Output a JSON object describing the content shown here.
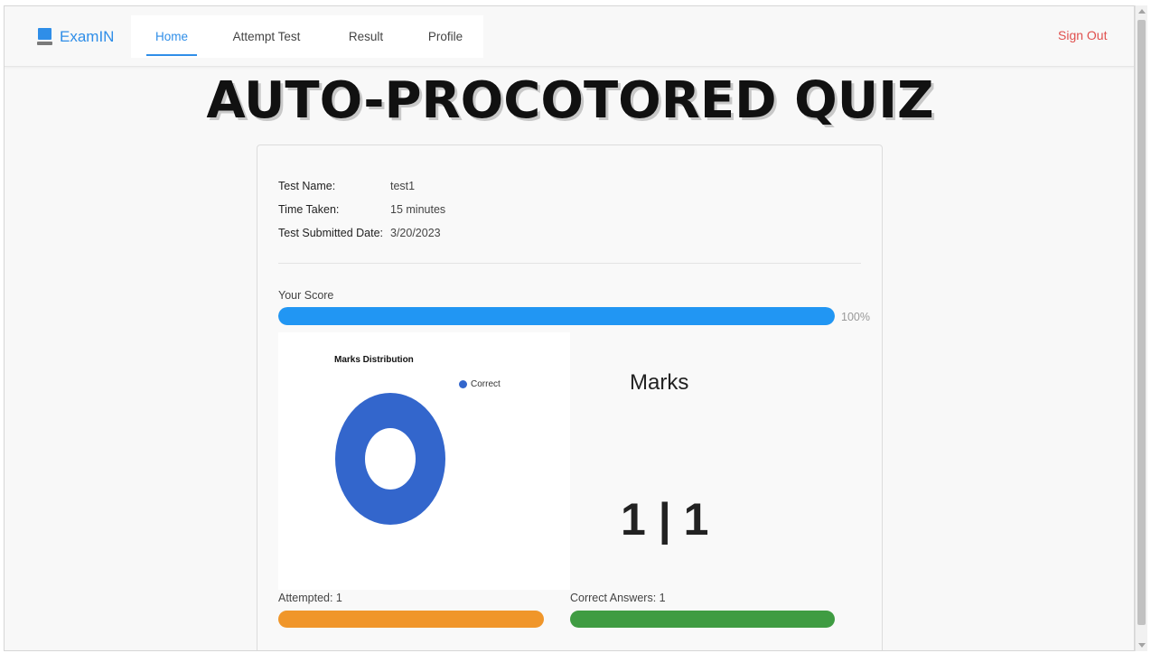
{
  "brand": {
    "name": "ExamIN",
    "icon": "laptop-icon",
    "color": "#2f8ee8"
  },
  "nav": {
    "tabs": [
      {
        "label": "Home",
        "active": true
      },
      {
        "label": "Attempt Test",
        "active": false
      },
      {
        "label": "Result",
        "active": false
      },
      {
        "label": "Profile",
        "active": false
      }
    ],
    "signout_label": "Sign Out"
  },
  "headline": "AUTO-PROCOTORED QUIZ",
  "result": {
    "test_name_label": "Test Name:",
    "test_name": "test1",
    "time_taken_label": "Time Taken:",
    "time_taken": "15 minutes",
    "submitted_label": "Test Submitted Date:",
    "submitted_date": "3/20/2023",
    "score_label": "Your Score",
    "score_percent": 100,
    "score_text": "100%",
    "marks_title": "Marks",
    "marks_value": "1 | 1",
    "attempted_label": "Attempted: 1",
    "correct_label": "Correct Answers: 1"
  },
  "colors": {
    "score_bar": "#2196f3",
    "attempted_bar": "#f0962a",
    "correct_bar": "#3f9c42",
    "donut": "#3366cc",
    "signout": "#e0504e"
  },
  "chart_data": {
    "type": "pie",
    "title": "Marks Distribution",
    "categories": [
      "Correct"
    ],
    "values": [
      1
    ],
    "legend_position": "top-right",
    "donut": true
  }
}
